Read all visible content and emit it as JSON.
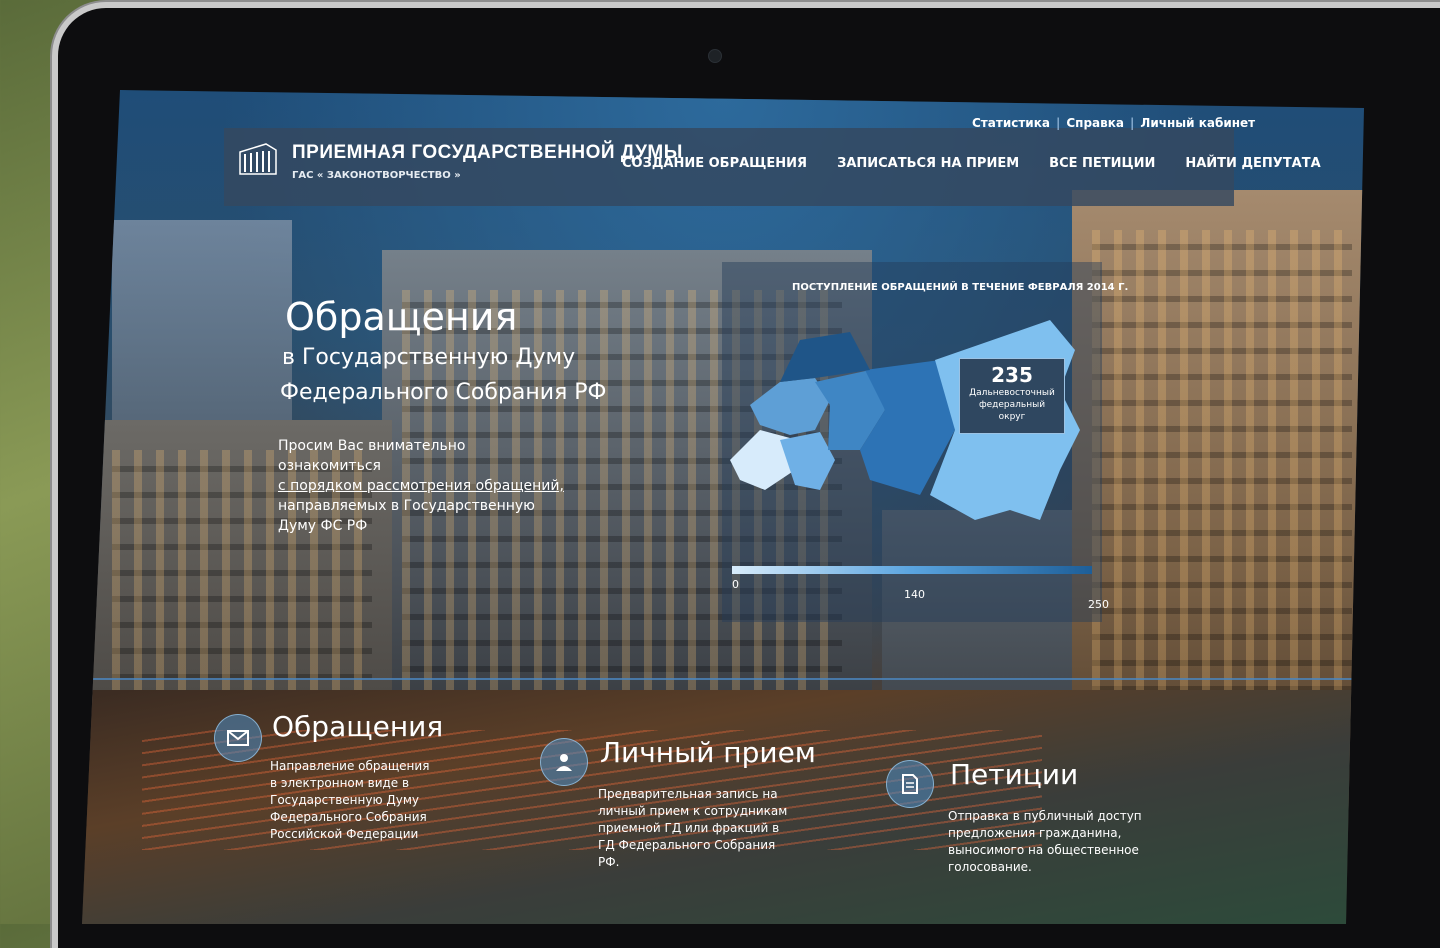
{
  "header": {
    "logo_title": "ПРИЕМНАЯ ГОСУДАРСТВЕННОЙ ДУМЫ",
    "logo_subtitle": "ГАС « ЗАКОНОТВОРЧЕСТВО »",
    "top_links": [
      "Статистика",
      "Справка",
      "Личный кабинет"
    ],
    "nav": [
      "СОЗДАНИЕ ОБРАЩЕНИЯ",
      "ЗАПИСАТЬСЯ НА ПРИЕМ",
      "ВСЕ ПЕТИЦИИ",
      "НАЙТИ ДЕПУТАТА"
    ]
  },
  "hero": {
    "title": "Обращения",
    "subtitle_line1": "в Государственную Думу",
    "subtitle_line2": "Федерального Собрания РФ",
    "text_before": "Просим Вас внимательно ознакомиться",
    "link": "с порядком рассмотрения обращений,",
    "text_after": "направляемых в Государственную Думу ФС РФ"
  },
  "map": {
    "caption": "ПОСТУПЛЕНИЕ ОБРАЩЕНИЙ В ТЕЧЕНИЕ ФЕВРАЛЯ 2014 Г.",
    "badge_value": "235",
    "badge_label_1": "Дальневосточный",
    "badge_label_2": "федеральный",
    "badge_label_3": "округ",
    "scale_min": "0",
    "scale_mid": "140",
    "scale_max": "250"
  },
  "features": [
    {
      "title": "Обращения",
      "text": "Направление обращения в электронном виде в Государственную Думу Федерального Собрания Российской Федерации",
      "icon": "envelope-icon"
    },
    {
      "title": "Личный прием",
      "text": "Предварительная запись на личный прием к сотрудникам приемной ГД или фракций в ГД Федерального Собрания РФ.",
      "icon": "person-icon"
    },
    {
      "title": "Петиции",
      "text": "Отправка в публичный доступ предложения гражданина, выносимого на общественное голосование.",
      "icon": "document-icon"
    }
  ],
  "colors": {
    "accent": "#4b86bf",
    "header_bg": "#34485f"
  }
}
